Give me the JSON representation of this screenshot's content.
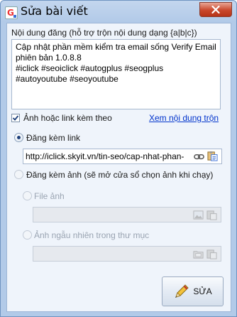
{
  "window": {
    "title": "Sửa bài viết"
  },
  "content": {
    "label": "Nội dung đăng (hỗ trợ trộn nội dung dạng {a|b|c})",
    "lines": [
      "Cập nhật phần mềm kiểm tra email sống Verify Email",
      "phiên bản 1.0.8.8",
      "#iclick #seoiclick #autogplus #seogplus",
      "#autoyoutube #seoyoutube"
    ]
  },
  "attach": {
    "checkbox_label": "Ảnh hoặc link kèm theo",
    "checked": true,
    "preview_link": "Xem nội dung trộn",
    "link_option": {
      "label": "Đăng kèm link",
      "selected": true,
      "value": "http://iclick.skyit.vn/tin-seo/cap-nhat-phan-"
    },
    "image_option": {
      "label": "Đăng kèm ảnh (sẽ mở cửa sổ chọn ảnh khi chạy)",
      "selected": false
    },
    "file_option": {
      "label": "File ảnh",
      "value": ""
    },
    "random_option": {
      "label": "Ảnh ngẫu nhiên trong thư mục",
      "value": ""
    }
  },
  "submit": {
    "label": "SỬA"
  },
  "icons": {
    "link": "link-icon",
    "paste": "paste-icon",
    "image": "image-icon",
    "folder": "folder-icon",
    "pencil": "pencil-icon"
  }
}
